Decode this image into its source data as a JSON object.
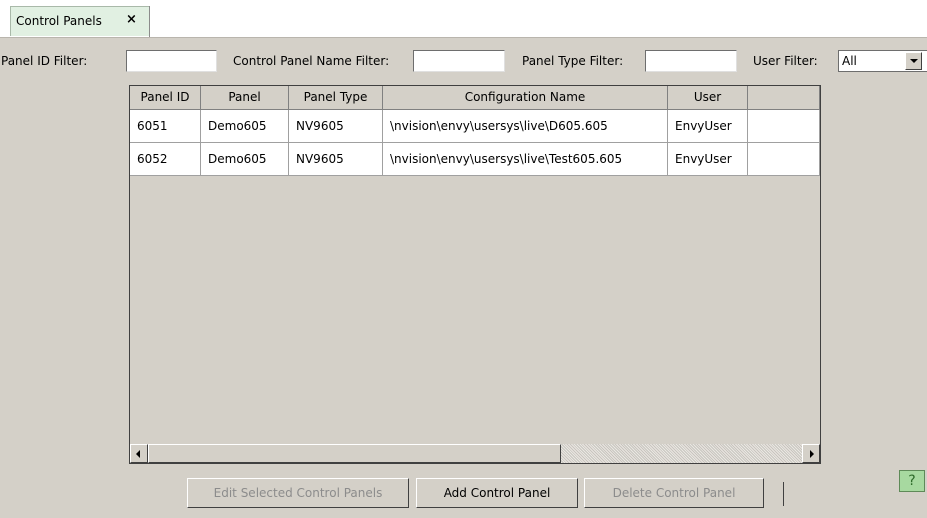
{
  "tab": {
    "label": "Control Panels",
    "close": "×"
  },
  "filters": {
    "panel_id_label": "Panel ID Filter:",
    "panel_id_value": "",
    "name_label": "Control Panel Name Filter:",
    "name_value": "",
    "type_label": "Panel Type Filter:",
    "type_value": "",
    "user_label": "User Filter:",
    "user_value": "All"
  },
  "table": {
    "headers": [
      "Panel ID",
      "Panel",
      "Panel Type",
      "Configuration Name",
      "User",
      ""
    ],
    "rows": [
      [
        "6051",
        "Demo605",
        "NV9605",
        "\\nvision\\envy\\usersys\\live\\D605.605",
        "EnvyUser",
        ""
      ],
      [
        "6052",
        "Demo605",
        "NV9605",
        "\\nvision\\envy\\usersys\\live\\Test605.605",
        "EnvyUser",
        ""
      ]
    ]
  },
  "buttons": {
    "edit": "Edit Selected Control Panels",
    "add": "Add Control Panel",
    "delete": "Delete Control Panel",
    "help": "?"
  }
}
